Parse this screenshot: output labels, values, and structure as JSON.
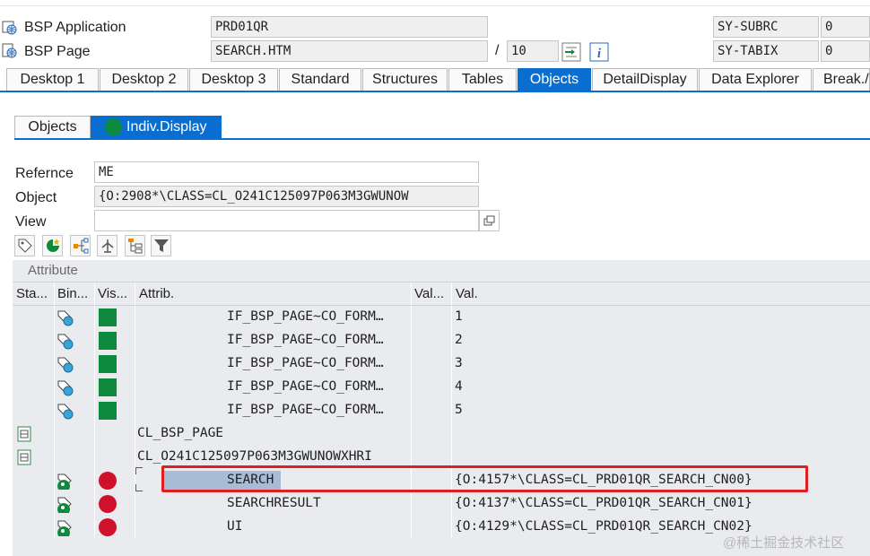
{
  "header": {
    "app_label": "BSP Application",
    "app_value": "PRD01QR",
    "page_label": "BSP Page",
    "page_value": "SEARCH.HTM",
    "slash": "/",
    "page_count": "10",
    "subrc_label": "SY-SUBRC",
    "subrc_value": "0",
    "tabix_label": "SY-TABIX",
    "tabix_value": "0"
  },
  "tabs": [
    "Desktop 1",
    "Desktop 2",
    "Desktop 3",
    "Standard",
    "Structures",
    "Tables",
    "Objects",
    "DetailDisplay",
    "Data Explorer",
    "Break./"
  ],
  "active_tab": "Objects",
  "subtabs": {
    "objects": "Objects",
    "indiv_display": "Indiv.Display"
  },
  "form": {
    "reference_label": "Refernce",
    "reference_value": "ME",
    "object_label": "Object",
    "object_value": "{O:2908*\\CLASS=CL_O241C125097P063M3GWUNOW",
    "view_label": "View",
    "view_value": ""
  },
  "toolbar_icons": [
    "tag-icon",
    "pie-star-icon",
    "hierarchy-icon",
    "split-icon",
    "tree-icon",
    "filter-icon"
  ],
  "grid": {
    "title": "Attribute",
    "columns": [
      "Sta...",
      "Bin...",
      "Vis...",
      "Attrib.",
      "Val...",
      "Val."
    ],
    "rows": [
      {
        "attrib": "IF_BSP_PAGE~CO_FORM…",
        "val": "1"
      },
      {
        "attrib": "IF_BSP_PAGE~CO_FORM…",
        "val": "2"
      },
      {
        "attrib": "IF_BSP_PAGE~CO_FORM…",
        "val": "3"
      },
      {
        "attrib": "IF_BSP_PAGE~CO_FORM…",
        "val": "4"
      },
      {
        "attrib": "IF_BSP_PAGE~CO_FORM…",
        "val": "5"
      },
      {
        "attrib": "CL_BSP_PAGE",
        "val": ""
      },
      {
        "attrib": "CL_O241C125097P063M3GWUNOWXHRI",
        "val": ""
      },
      {
        "attrib": "SEARCH",
        "val": "{O:4157*\\CLASS=CL_PRD01QR_SEARCH_CN00}"
      },
      {
        "attrib": "SEARCHRESULT",
        "val": "{O:4137*\\CLASS=CL_PRD01QR_SEARCH_CN01}"
      },
      {
        "attrib": "UI",
        "val": "{O:4129*\\CLASS=CL_PRD01QR_SEARCH_CN02}"
      }
    ]
  },
  "watermark": "@稀土掘金技术社区",
  "colors": {
    "accent": "#0a6ed1",
    "visible_green": "#0e8a3e",
    "private_red": "#d0112b",
    "highlight_border": "#e02020",
    "selection": "#a9bcd6"
  }
}
